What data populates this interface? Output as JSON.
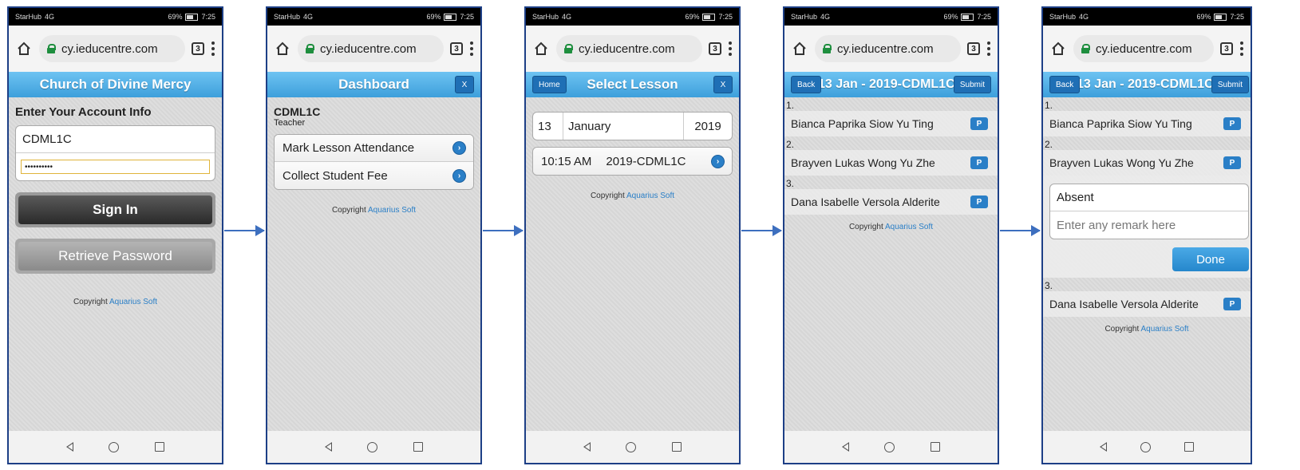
{
  "statusbar": {
    "carrier": "StarHub",
    "signal": "4G",
    "battery": "69%",
    "time": "7:25"
  },
  "browser": {
    "url": "cy.ieducentre.com",
    "tab_count": "3"
  },
  "copyright": {
    "prefix": "Copyright",
    "link": "Aquarius Soft"
  },
  "screen1": {
    "title": "Church of Divine Mercy",
    "heading": "Enter Your Account Info",
    "username": "CDML1C",
    "password": "••••••••••",
    "signin_label": "Sign In",
    "retrieve_label": "Retrieve Password"
  },
  "screen2": {
    "title": "Dashboard",
    "close_label": "X",
    "user_name": "CDML1C",
    "user_role": "Teacher",
    "menu": [
      "Mark Lesson Attendance",
      "Collect Student Fee"
    ]
  },
  "screen3": {
    "title": "Select Lesson",
    "home_label": "Home",
    "close_label": "X",
    "day": "13",
    "month": "January",
    "year": "2019",
    "lesson_time": "10:15 AM",
    "lesson_class": "2019-CDML1C"
  },
  "screen4": {
    "title": "13 Jan - 2019-CDML1C",
    "back_label": "Back",
    "submit_label": "Submit",
    "students": [
      {
        "num": "1.",
        "name": "Bianca Paprika Siow Yu Ting",
        "status": "P"
      },
      {
        "num": "2.",
        "name": "Brayven Lukas Wong Yu Zhe",
        "status": "P"
      },
      {
        "num": "3.",
        "name": "Dana Isabelle Versola Alderite",
        "status": "P"
      }
    ]
  },
  "screen5": {
    "title": "13 Jan - 2019-CDML1C",
    "back_label": "Back",
    "submit_label": "Submit",
    "absent_label": "Absent",
    "remark_placeholder": "Enter any remark here",
    "done_label": "Done"
  }
}
